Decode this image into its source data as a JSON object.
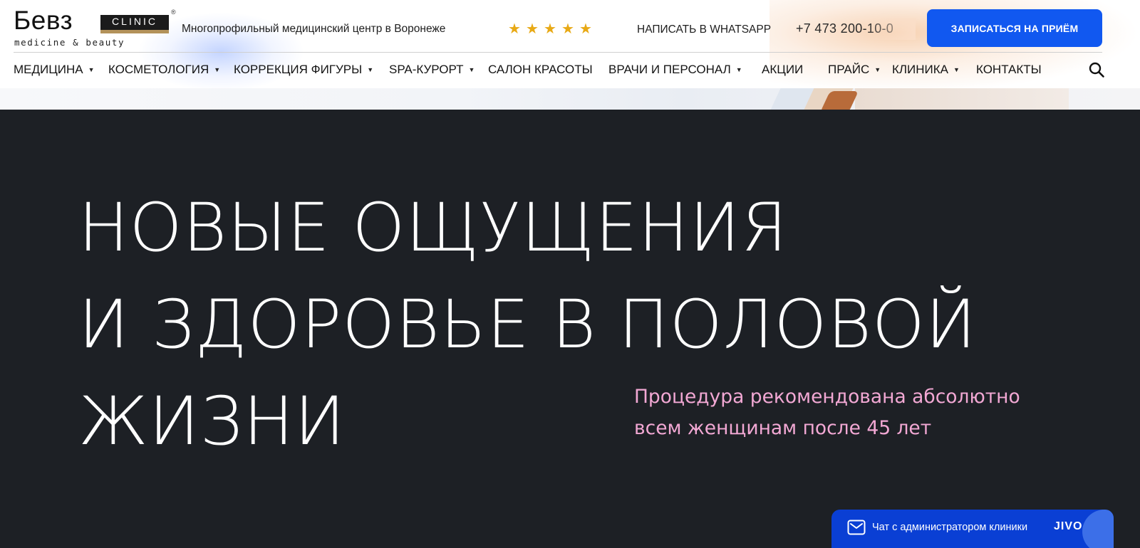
{
  "header": {
    "logo": {
      "name": "Бевз",
      "badge": "CLINIC",
      "registered": "®",
      "subtitle": "medicine & beauty"
    },
    "tagline": "Многопрофильный медицинский центр в Воронеже",
    "rating": {
      "stars": 5,
      "star_glyph": "★"
    },
    "whatsapp_label": "НАПИСАТЬ В WHATSAPP",
    "phone": "+7 473 200-10-0",
    "cta_label": "ЗАПИСАТЬСЯ НА ПРИЁМ"
  },
  "nav": {
    "caret": "▼",
    "items": [
      {
        "label": "МЕДИЦИНА",
        "has_dropdown": true
      },
      {
        "label": "КОСМЕТОЛОГИЯ",
        "has_dropdown": true
      },
      {
        "label": "КОРРЕКЦИЯ ФИГУРЫ",
        "has_dropdown": true
      },
      {
        "label": "SPA-КУРОРТ",
        "has_dropdown": true
      },
      {
        "label": "САЛОН КРАСОТЫ",
        "has_dropdown": false
      },
      {
        "label": "ВРАЧИ И ПЕРСОНАЛ",
        "has_dropdown": true
      },
      {
        "label": "АКЦИИ",
        "has_dropdown": false
      },
      {
        "label": "ПРАЙС",
        "has_dropdown": true
      },
      {
        "label": "КЛИНИКА",
        "has_dropdown": true
      },
      {
        "label": "КОНТАКТЫ",
        "has_dropdown": false
      }
    ],
    "search_icon": "search-icon"
  },
  "hero": {
    "title_lines": [
      "НОВЫЕ ОЩУЩЕНИЯ",
      "И ЗДОРОВЬЕ В ПОЛОВОЙ",
      "ЖИЗНИ"
    ],
    "subtitle_lines": [
      "Процедура рекомендована абсолютно",
      "всем женщинам после 45 лет"
    ]
  },
  "chat_widget": {
    "label": "Чат с администратором клиники",
    "brand": "JIVO",
    "icon": "mail-icon"
  },
  "colors": {
    "hero_background": "#1d2025",
    "accent_blue": "#1158f0",
    "subtitle_pink": "#f2a8d4",
    "star_gold": "#e8a915",
    "chat_blue": "#0a3fd4"
  }
}
